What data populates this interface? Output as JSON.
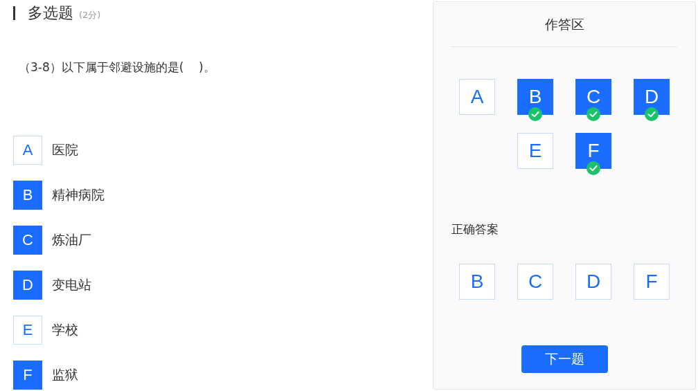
{
  "question": {
    "type": "多选题",
    "score": "(2分)",
    "stem": "（3-8）以下属于邻避设施的是(    )。"
  },
  "options": [
    {
      "letter": "A",
      "text": "医院",
      "selected": false
    },
    {
      "letter": "B",
      "text": "精神病院",
      "selected": true
    },
    {
      "letter": "C",
      "text": "炼油厂",
      "selected": true
    },
    {
      "letter": "D",
      "text": "变电站",
      "selected": true
    },
    {
      "letter": "E",
      "text": "学校",
      "selected": false
    },
    {
      "letter": "F",
      "text": "监狱",
      "selected": true
    }
  ],
  "answer_panel": {
    "title": "作答区",
    "answers": [
      {
        "letter": "A",
        "selected": false
      },
      {
        "letter": "B",
        "selected": true
      },
      {
        "letter": "C",
        "selected": true
      },
      {
        "letter": "D",
        "selected": true
      },
      {
        "letter": "E",
        "selected": false
      },
      {
        "letter": "F",
        "selected": true
      }
    ],
    "correct_label": "正确答案",
    "correct_answers": [
      "B",
      "C",
      "D",
      "F"
    ],
    "next_button": "下一题"
  }
}
